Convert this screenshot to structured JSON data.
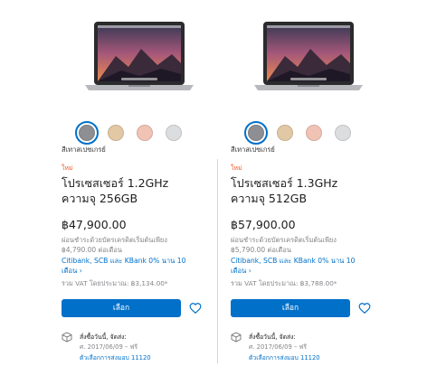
{
  "colors": {
    "accent": "#0070c9",
    "new_badge": "#ef5b27",
    "space_gray": "#8e8f93",
    "gold": "#e3c8a5",
    "rose_gold": "#f0c3b4",
    "silver": "#dcdddf"
  },
  "products": [
    {
      "new_label": "ใหม่",
      "swatch_label": "สีเทาสเปซเกรย์",
      "title_line1": "โปรเซสเซอร์ 1.2GHz",
      "title_line2": "ความจุ 256GB",
      "price": "฿47,900.00",
      "finance_line1": "ผ่อนชำระด้วยบัตรเครดิตเริ่มต้นเพียง",
      "finance_line2": "฿4,790.00 ต่อเดือน",
      "bank_line1": "Citibank, SCB และ KBank 0% นาน 10",
      "bank_line2": "เดือน ›",
      "vat": "รวม VAT โดยประมาณ: ฿3,134.00*",
      "select_label": "เลือก",
      "ship_line1": "สั่งซื้อวันนี้, จัดส่ง:",
      "ship_line2": "ศ. 2017/06/09 – ฟรี",
      "ship_link": "ตัวเลือกการส่งมอบ 11120"
    },
    {
      "new_label": "ใหม่",
      "swatch_label": "สีเทาสเปซเกรย์",
      "title_line1": "โปรเซสเซอร์ 1.3GHz",
      "title_line2": "ความจุ 512GB",
      "price": "฿57,900.00",
      "finance_line1": "ผ่อนชำระด้วยบัตรเครดิตเริ่มต้นเพียง",
      "finance_line2": "฿5,790.00 ต่อเดือน",
      "bank_line1": "Citibank, SCB และ KBank 0% นาน 10",
      "bank_line2": "เดือน ›",
      "vat": "รวม VAT โดยประมาณ: ฿3,788.00*",
      "select_label": "เลือก",
      "ship_line1": "สั่งซื้อวันนี้, จัดส่ง:",
      "ship_line2": "ศ. 2017/06/09 – ฟรี",
      "ship_link": "ตัวเลือกการส่งมอบ 11120"
    }
  ]
}
